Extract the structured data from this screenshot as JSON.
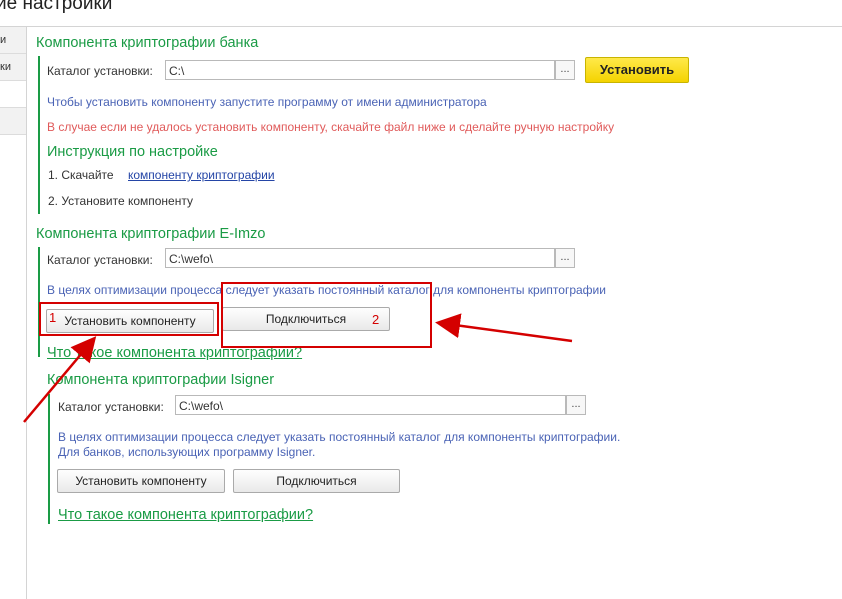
{
  "window": {
    "title": "ие настройки"
  },
  "sidebar": {
    "items": [
      "и",
      "ки"
    ]
  },
  "bank": {
    "title": "Компонента криптографии банка",
    "catalog_label": "Каталог установки:",
    "catalog_value": "C:\\",
    "dots": "...",
    "install_label": "Установить",
    "hint_admin": "Чтобы установить компоненту запустите программу от имени администратора",
    "hint_manual": "В случае если не удалось установить компоненту, скачайте файл ниже и сделайте ручную настройку",
    "instr_title": "Инструкция по настройке",
    "step1": "1. Скачайте",
    "step1_link": "компоненту криптографии",
    "step2": "2. Установите компоненту"
  },
  "eimzo": {
    "title": "Компонента криптографии E-Imzo",
    "catalog_label": "Каталог установки:",
    "catalog_value": "C:\\wefo\\",
    "dots": "...",
    "hint": "В целях оптимизации процесса следует указать постоянный каталог для компоненты криптографии",
    "install_label": "Установить компоненту",
    "connect_label": "Подключиться",
    "link": "Что такое компонента криптографии?"
  },
  "isigner": {
    "title": "Компонента криптографии Isigner",
    "catalog_label": "Каталог установки:",
    "catalog_value": "C:\\wefo\\",
    "dots": "...",
    "hint1": "В целях оптимизации процесса следует указать постоянный каталог для компоненты криптографии.",
    "hint2": "Для банков, использующих программу Isigner.",
    "install_label": "Установить компоненту",
    "connect_label": "Подключиться",
    "link": "Что такое компонента криптографии?"
  },
  "annotations": {
    "num1": "1",
    "num2": "2",
    "color": "#d40000"
  }
}
